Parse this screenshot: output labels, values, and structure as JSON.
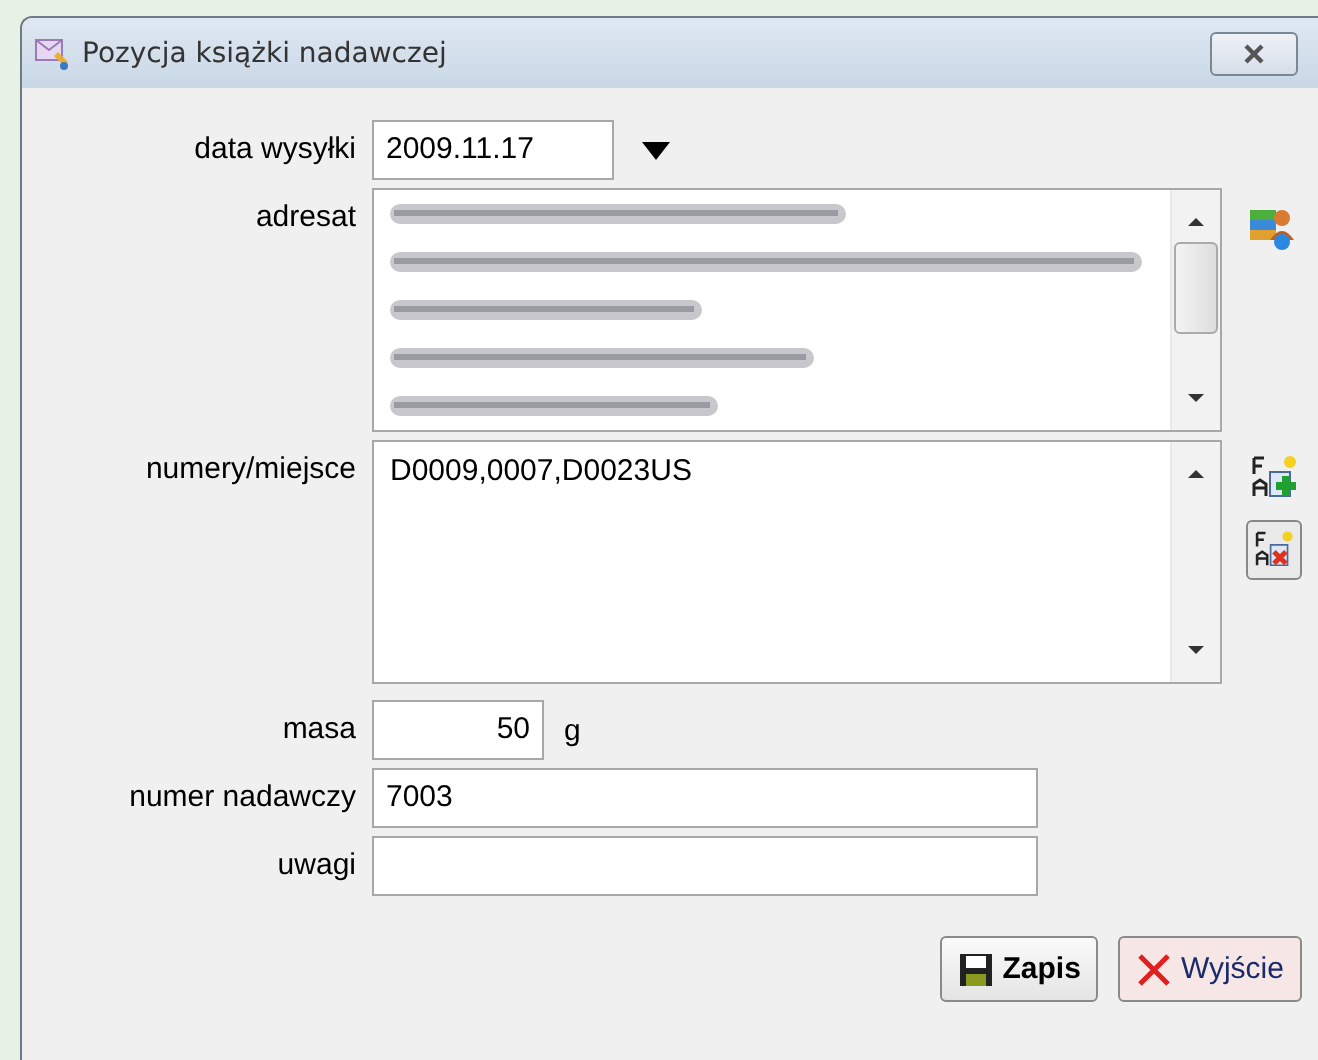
{
  "window": {
    "title": "Pozycja książki nadawczej"
  },
  "form": {
    "date": {
      "label": "data wysyłki",
      "value": "2009.11.17"
    },
    "addressee": {
      "label": "adresat"
    },
    "numbers": {
      "label": "numery/miejsce",
      "value": "D0009,0007,D0023US"
    },
    "mass": {
      "label": "masa",
      "value": "50",
      "unit": "g"
    },
    "sender_number": {
      "label": "numer nadawczy",
      "value": "7003"
    },
    "notes": {
      "label": "uwagi"
    }
  },
  "buttons": [
    {
      "kind": "save",
      "label": "Zapis"
    },
    {
      "kind": "exit",
      "label": "Wyjście"
    }
  ]
}
